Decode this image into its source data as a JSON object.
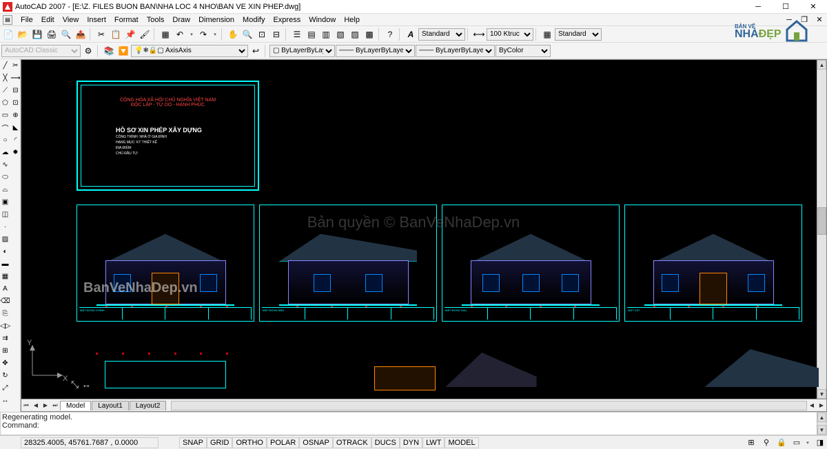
{
  "app": {
    "title": "AutoCAD 2007 - [E:\\Z. FILES BUON BAN\\NHA LOC 4 NHO\\BAN VE XIN PHEP.dwg]"
  },
  "menu": [
    "File",
    "Edit",
    "View",
    "Insert",
    "Format",
    "Tools",
    "Draw",
    "Dimension",
    "Modify",
    "Express",
    "Window",
    "Help"
  ],
  "style_toolbar": {
    "text_style": "Standard",
    "dim_style": "100 Ktruc",
    "table_style": "Standard"
  },
  "layers_toolbar": {
    "current_layer": "Axis",
    "classic_ws": "AutoCAD Classic"
  },
  "properties_toolbar": {
    "color": "ByLayer",
    "linetype": "ByLayer",
    "lineweight": "ByLayer",
    "plot_style": "ByColor"
  },
  "canvas": {
    "cover": {
      "header_red": "CỘNG HÒA XÃ HỘI CHỦ NGHĨA VIỆT NAM",
      "header_red2": "ĐỘC LẬP - TỰ DO - HẠNH PHÚC",
      "title": "HỒ SƠ XIN PHÉP XÂY DỰNG",
      "sub1": "CÔNG TRÌNH: NHÀ Ở GIA ĐÌNH",
      "sub2": "HẠNG MỤC: KT THIẾT KẾ",
      "sub3": "ĐỊA ĐIỂM:",
      "sub4": "CHỦ ĐẦU TƯ:"
    },
    "sheets": [
      {
        "label": "MẶT ĐỨNG CHÍNH"
      },
      {
        "label": "MẶT ĐỨNG BÊN"
      },
      {
        "label": "MẶT ĐỨNG SAU"
      },
      {
        "label": "MẶT CẮT"
      }
    ],
    "ucs": {
      "x": "X",
      "y": "Y"
    },
    "arrows": "↕ ↔"
  },
  "watermarks": {
    "left": "BanVeNhaDep.vn",
    "center": "Bản quyền © BanVeNhaDep.vn",
    "logo": {
      "t1": "BẢN VẼ",
      "t2": "NHÀ",
      "t3": "ĐẸP"
    }
  },
  "layout_tabs": [
    "Model",
    "Layout1",
    "Layout2"
  ],
  "command": {
    "line1": "Regenerating model.",
    "line2": "Command:"
  },
  "status": {
    "coords": "28325.4005, 45761.7687 , 0.0000",
    "toggles": [
      "SNAP",
      "GRID",
      "ORTHO",
      "POLAR",
      "OSNAP",
      "OTRACK",
      "DUCS",
      "DYN",
      "LWT",
      "MODEL"
    ]
  }
}
